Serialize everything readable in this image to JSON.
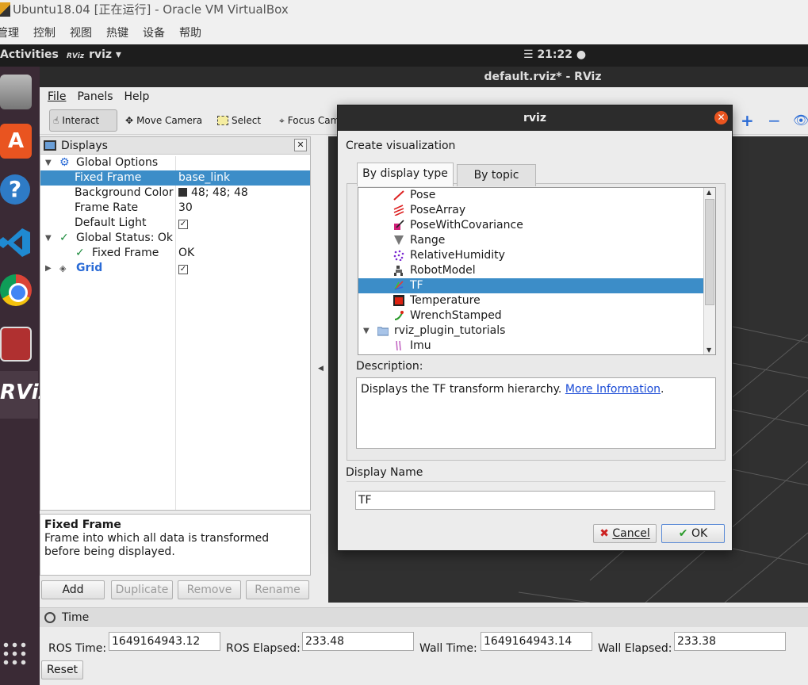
{
  "vbox": {
    "title": "Ubuntu18.04 [正在运行] - Oracle VM VirtualBox",
    "menu": [
      "管理",
      "控制",
      "视图",
      "热键",
      "设备",
      "帮助"
    ]
  },
  "ubuntu": {
    "activities": "Activities",
    "app_name": "rviz",
    "clock": "21:22"
  },
  "rviz": {
    "window_title": "default.rviz* - RViz",
    "menu": {
      "file": "File",
      "panels": "Panels",
      "help": "Help"
    },
    "toolbar": {
      "interact": "Interact",
      "move_camera": "Move Camera",
      "select": "Select",
      "focus_camera": "Focus Cam"
    }
  },
  "displays": {
    "title": "Displays",
    "rows": [
      {
        "label": "Global Options",
        "value": ""
      },
      {
        "label": "Fixed Frame",
        "value": "base_link"
      },
      {
        "label": "Background Color",
        "value": "48; 48; 48"
      },
      {
        "label": "Frame Rate",
        "value": "30"
      },
      {
        "label": "Default Light",
        "value": "✓"
      },
      {
        "label": "Global Status: Ok",
        "value": ""
      },
      {
        "label": "Fixed Frame",
        "value": "OK"
      },
      {
        "label": "Grid",
        "value": "✓"
      }
    ],
    "description": {
      "title": "Fixed Frame",
      "text": "Frame into which all data is transformed before being displayed."
    },
    "buttons": {
      "add": "Add",
      "duplicate": "Duplicate",
      "remove": "Remove",
      "rename": "Rename"
    }
  },
  "time": {
    "title": "Time",
    "ros_time_label": "ROS Time:",
    "ros_time": "1649164943.12",
    "ros_elapsed_label": "ROS Elapsed:",
    "ros_elapsed": "233.48",
    "wall_time_label": "Wall Time:",
    "wall_time": "1649164943.14",
    "wall_elapsed_label": "Wall Elapsed:",
    "wall_elapsed": "233.38",
    "reset": "Reset"
  },
  "dialog": {
    "title": "rviz",
    "create_label": "Create visualization",
    "tabs": {
      "by_display_type": "By display type",
      "by_topic": "By topic"
    },
    "items": [
      {
        "label": "Pose",
        "icon": "pose-icon"
      },
      {
        "label": "PoseArray",
        "icon": "posearray-icon"
      },
      {
        "label": "PoseWithCovariance",
        "icon": "posewithcovariance-icon"
      },
      {
        "label": "Range",
        "icon": "range-icon"
      },
      {
        "label": "RelativeHumidity",
        "icon": "humidity-icon"
      },
      {
        "label": "RobotModel",
        "icon": "robotmodel-icon"
      },
      {
        "label": "TF",
        "icon": "tf-icon"
      },
      {
        "label": "Temperature",
        "icon": "temperature-icon"
      },
      {
        "label": "WrenchStamped",
        "icon": "wrench-icon"
      },
      {
        "label": "rviz_plugin_tutorials",
        "icon": "folder-icon"
      },
      {
        "label": "Imu",
        "icon": "imu-icon"
      }
    ],
    "description_label": "Description:",
    "description_text": "Displays the TF transform hierarchy.",
    "more_info": "More Information",
    "description_end": ".",
    "display_name_label": "Display Name",
    "display_name": "TF",
    "cancel": "Cancel",
    "ok": "OK"
  },
  "colors": {
    "selection": "#3c8dc8",
    "view_bg": "#303030",
    "ubuntu_orange": "#e9541f"
  }
}
